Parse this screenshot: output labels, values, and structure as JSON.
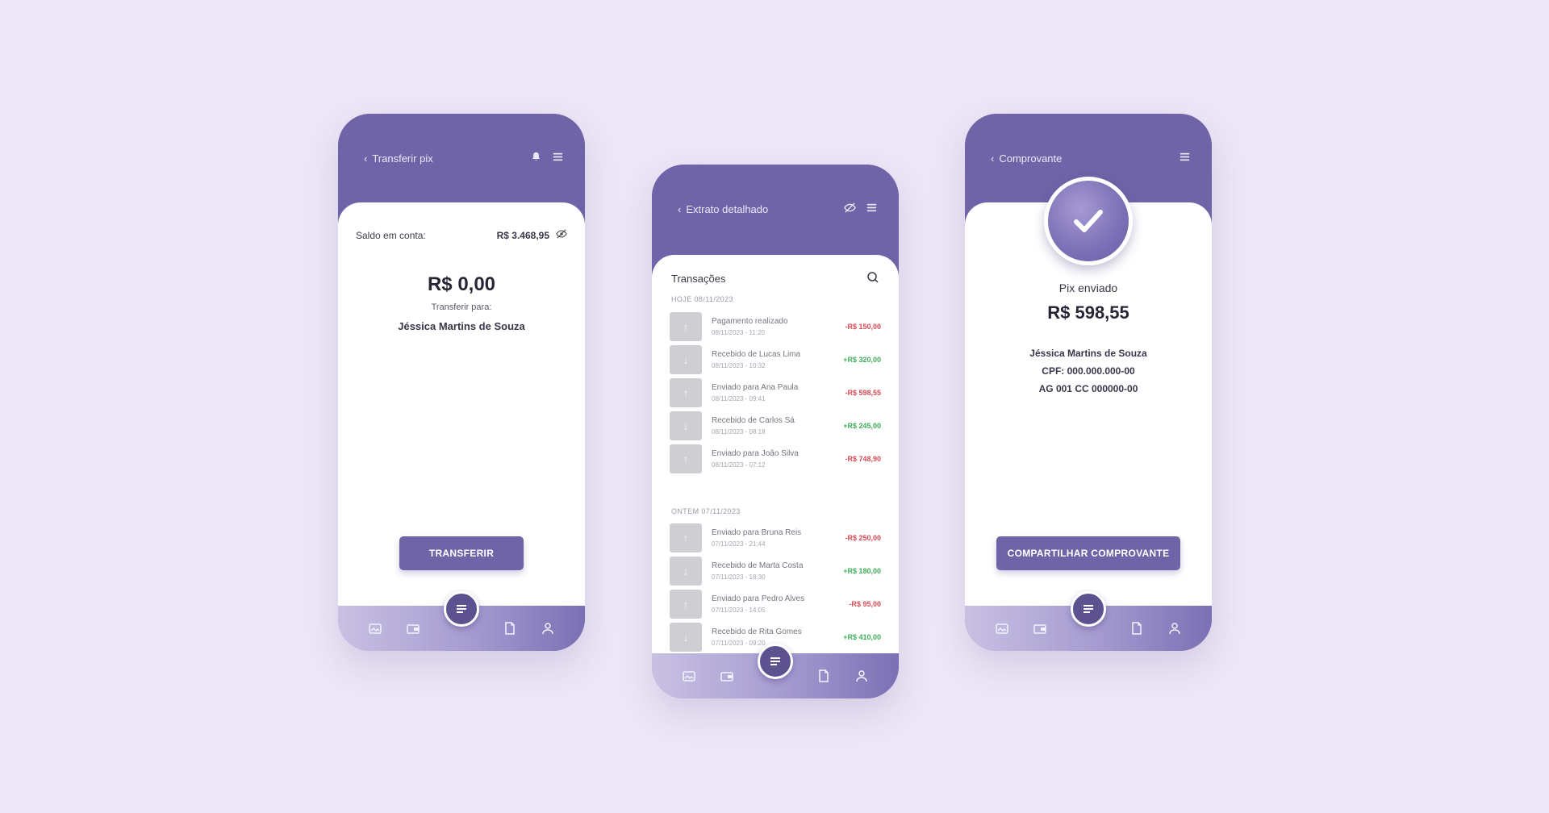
{
  "colors": {
    "background": "#ede6f6",
    "brand": "#6f64a8",
    "negative": "#d84a55",
    "positive": "#3fae5a"
  },
  "phone1": {
    "header": {
      "title": "Transferir pix",
      "icons": [
        "bell-icon",
        "menu-icon"
      ]
    },
    "balance_label": "Saldo em conta:",
    "balance_value": "R$ 3.468,95",
    "amount": "R$ 0,00",
    "transfer_to_label": "Transferir para:",
    "recipient_name": "Jéssica Martins de Souza",
    "primary_button": "TRANSFERIR"
  },
  "phone2": {
    "header": {
      "title": "Extrato detalhado",
      "icons": [
        "eye-off-icon",
        "menu-icon"
      ]
    },
    "transactions_title": "Transações",
    "sections": [
      {
        "label": "HOJE 08/11/2023",
        "items": [
          {
            "title": "Pagamento realizado",
            "date": "08/11/2023 - 11:20",
            "amount": "-R$ 150,00",
            "type": "neg"
          },
          {
            "title": "Recebido de Lucas Lima",
            "date": "08/11/2023 - 10:32",
            "amount": "+R$ 320,00",
            "type": "pos"
          },
          {
            "title": "Enviado para Ana Paula",
            "date": "08/11/2023 - 09:41",
            "amount": "-R$ 598,55",
            "type": "neg"
          },
          {
            "title": "Recebido de Carlos Sá",
            "date": "08/11/2023 - 08:18",
            "amount": "+R$ 245,00",
            "type": "pos"
          },
          {
            "title": "Enviado para João Silva",
            "date": "08/11/2023 - 07:12",
            "amount": "-R$ 748,90",
            "type": "neg"
          }
        ]
      },
      {
        "label": "ONTEM 07/11/2023",
        "items": [
          {
            "title": "Enviado para Bruna Reis",
            "date": "07/11/2023 - 21:44",
            "amount": "-R$ 250,00",
            "type": "neg"
          },
          {
            "title": "Recebido de Marta Costa",
            "date": "07/11/2023 - 18:30",
            "amount": "+R$ 180,00",
            "type": "pos"
          },
          {
            "title": "Enviado para Pedro Alves",
            "date": "07/11/2023 - 14:05",
            "amount": "-R$ 95,00",
            "type": "neg"
          },
          {
            "title": "Recebido de Rita Gomes",
            "date": "07/11/2023 - 09:20",
            "amount": "+R$ 410,00",
            "type": "pos"
          }
        ]
      }
    ]
  },
  "phone3": {
    "header": {
      "title": "Comprovante",
      "icons": [
        "menu-icon"
      ]
    },
    "status_label": "Pix enviado",
    "amount": "R$ 598,55",
    "recipient_name": "Jéssica Martins de Souza",
    "cpf_line": "CPF: 000.000.000-00",
    "account_line": "AG 001 CC 000000-00",
    "primary_button": "COMPARTILHAR COMPROVANTE"
  },
  "bottom_nav": {
    "items": [
      "home-icon",
      "wallet-icon",
      "pix-icon",
      "document-icon",
      "profile-icon"
    ]
  }
}
